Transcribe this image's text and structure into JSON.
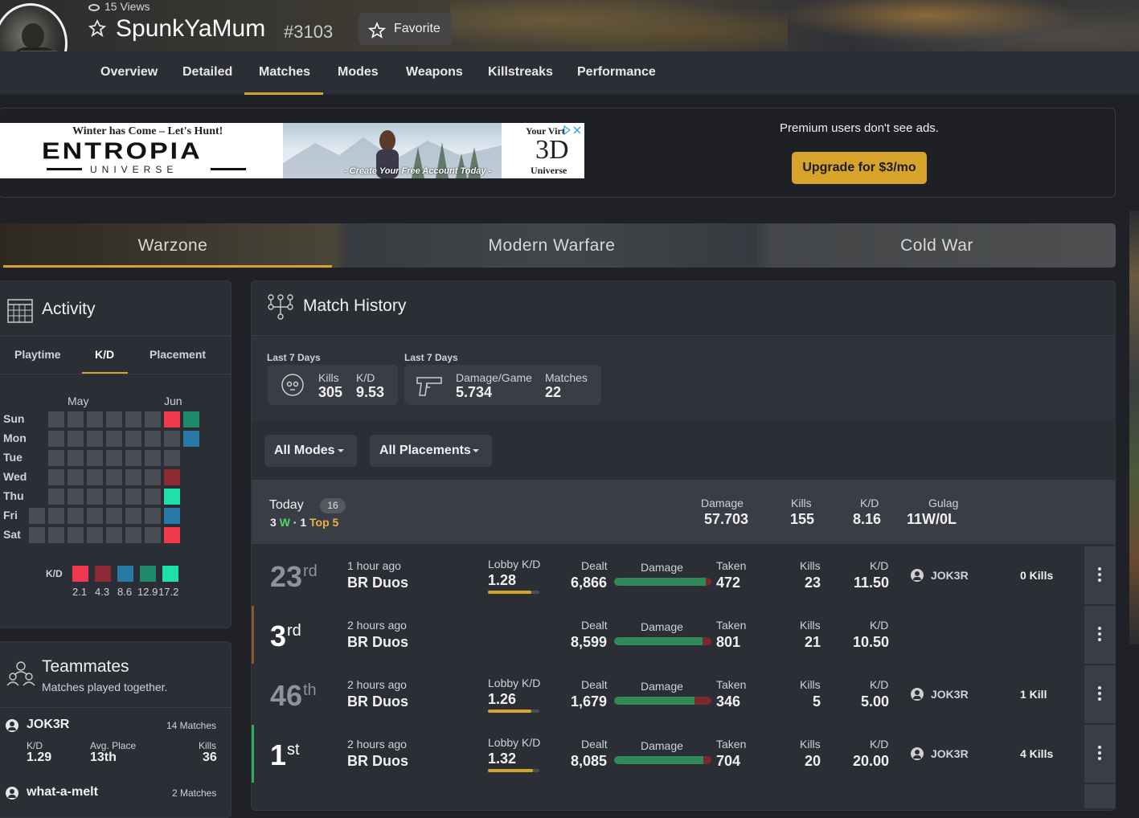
{
  "profile": {
    "views": "15 Views",
    "name": "SpunkYaMum",
    "tag": "#3103",
    "favorite": "Favorite"
  },
  "nav": {
    "tabs": [
      "Overview",
      "Detailed",
      "Matches",
      "Modes",
      "Weapons",
      "Killstreaks",
      "Performance"
    ],
    "active": "Matches"
  },
  "ad": {
    "headline": "Winter has Come – Let's Hunt!",
    "brand": "ENTROPIA",
    "brand_sub": "UNIVERSE",
    "cta": "- Create Your Free Account Today -",
    "right_top": "Your Virt",
    "right_big": "3D",
    "right_bottom": "Universe",
    "premium_text": "Premium users don't see ads.",
    "upgrade_button": "Upgrade for $3/mo"
  },
  "game_tabs": [
    "Warzone",
    "Modern Warfare",
    "Cold War"
  ],
  "activity": {
    "title": "Activity",
    "tabs": [
      "Playtime",
      "K/D",
      "Placement"
    ],
    "active_tab": "K/D",
    "months": [
      "May",
      "Jun"
    ],
    "days": [
      "Sun",
      "Mon",
      "Tue",
      "Wed",
      "Thu",
      "Fri",
      "Sat"
    ],
    "legend_label": "K/D",
    "legend": [
      {
        "value": "2.1",
        "color": "#f0394f"
      },
      {
        "value": "4.3",
        "color": "#8e2a34"
      },
      {
        "value": "8.6",
        "color": "#2a7aa8"
      },
      {
        "value": "12.9",
        "color": "#1f8a6a"
      },
      {
        "value": "17.2",
        "color": "#1fe0a8"
      }
    ],
    "highlights": [
      {
        "day": 0,
        "week": 7,
        "color": "#f0394f"
      },
      {
        "day": 0,
        "week": 8,
        "color": "#1f8a6a"
      },
      {
        "day": 1,
        "week": 8,
        "color": "#2a7aa8"
      },
      {
        "day": 3,
        "week": 7,
        "color": "#8e2a34"
      },
      {
        "day": 4,
        "week": 7,
        "color": "#1fe0a8"
      },
      {
        "day": 5,
        "week": 7,
        "color": "#2a7aa8"
      },
      {
        "day": 6,
        "week": 7,
        "color": "#f0394f"
      }
    ]
  },
  "teammates": {
    "title": "Teammates",
    "subtitle": "Matches played together.",
    "list": [
      {
        "name": "JOK3R",
        "matches": "14 Matches",
        "kd_label": "K/D",
        "kd": "1.29",
        "place_label": "Avg. Place",
        "place": "13th",
        "kills_label": "Kills",
        "kills": "36"
      },
      {
        "name": "what-a-melt",
        "matches": "2 Matches"
      }
    ]
  },
  "history": {
    "title": "Match History",
    "summary": [
      {
        "period": "Last 7 Days",
        "stats": [
          {
            "label": "Kills",
            "value": "305"
          },
          {
            "label": "K/D",
            "value": "9.53"
          }
        ]
      },
      {
        "period": "Last 7 Days",
        "stats": [
          {
            "label": "Damage/Game",
            "value": "5.734"
          },
          {
            "label": "Matches",
            "value": "22"
          }
        ]
      }
    ],
    "filters": [
      "All Modes",
      "All Placements"
    ],
    "day": {
      "label": "Today",
      "count": "16",
      "wins": "3",
      "wins_suffix": "W",
      "top": "1",
      "top_suffix": "Top 5",
      "stats": [
        {
          "label": "Damage",
          "value": "57.703"
        },
        {
          "label": "Kills",
          "value": "155"
        },
        {
          "label": "K/D",
          "value": "8.16"
        },
        {
          "label": "Gulag",
          "value": "11W/0L"
        }
      ]
    },
    "columns": {
      "lobby": "Lobby K/D",
      "dealt": "Dealt",
      "damage": "Damage",
      "taken": "Taken",
      "kills": "Kills",
      "kd": "K/D"
    },
    "matches": [
      {
        "place": "23",
        "suffix": "rd",
        "time": "1 hour ago",
        "mode": "BR Duos",
        "lobby_kd": "1.28",
        "lobby_fill": 0.85,
        "dealt": "6,866",
        "taken": "472",
        "dmg_ratio": 0.94,
        "kills": "23",
        "kd": "11.50",
        "teammate": "JOK3R",
        "tm_kills": "0 Kills",
        "accent": ""
      },
      {
        "place": "3",
        "suffix": "rd",
        "time": "2 hours ago",
        "mode": "BR Duos",
        "lobby_kd": "",
        "lobby_fill": 0,
        "dealt": "8,599",
        "taken": "801",
        "dmg_ratio": 0.91,
        "kills": "21",
        "kd": "10.50",
        "teammate": "",
        "tm_kills": "",
        "accent": "#8a5a2e"
      },
      {
        "place": "46",
        "suffix": "th",
        "time": "2 hours ago",
        "mode": "BR Duos",
        "lobby_kd": "1.26",
        "lobby_fill": 0.84,
        "dealt": "1,679",
        "taken": "346",
        "dmg_ratio": 0.83,
        "kills": "5",
        "kd": "5.00",
        "teammate": "JOK3R",
        "tm_kills": "1 Kill",
        "accent": ""
      },
      {
        "place": "1",
        "suffix": "st",
        "time": "2 hours ago",
        "mode": "BR Duos",
        "lobby_kd": "1.32",
        "lobby_fill": 0.88,
        "dealt": "8,085",
        "taken": "704",
        "dmg_ratio": 0.92,
        "kills": "20",
        "kd": "20.00",
        "teammate": "JOK3R",
        "tm_kills": "4 Kills",
        "accent": "#2fae5f"
      }
    ]
  },
  "colors": {
    "accent": "#d6a42a",
    "win": "#4cd964",
    "top": "#e6b440"
  }
}
